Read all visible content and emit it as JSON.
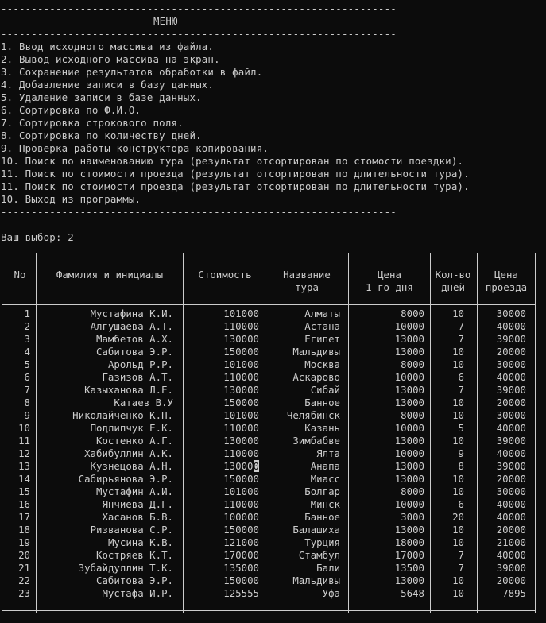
{
  "dash_line": "-----------------------------------------------------------------",
  "menu_title": "МЕНЮ",
  "menu_items": [
    "1. Ввод исходного массива из файла.",
    "2. Вывод исходного массива на экран.",
    "3. Сохранение результатов обработки в файл.",
    "4. Добавление записи в базу данных.",
    "5. Удаление записи в базе данных.",
    "6. Сортировка по Ф.И.О.",
    "7. Сортировка строкового поля.",
    "8. Сортировка по количеству дней.",
    "9. Проверка работы конструктора копирования.",
    "10. Поиск по наименованию тура (результат отсортирован по стомости поездки).",
    "11. Поиск по стоимости проезда (результат отсортирован по длительности тура).",
    "11. Поиск по стоимости проезда (результат отсортирован по длительности тура).",
    "10. Выход из программы."
  ],
  "prompt": "Ваш выбор: 2",
  "table": {
    "headers": {
      "no": "No",
      "name": "Фамилия и инициалы",
      "cost": "Стоимость",
      "tour_1": "Название",
      "tour_2": "тура",
      "price_1": "Цена",
      "price_2": "1-го дня",
      "days_1": "Кол-во",
      "days_2": "дней",
      "fare_1": "Цена",
      "fare_2": "проезда"
    },
    "rows": [
      [
        "1",
        "Мустафина К.И.",
        "101000",
        "Алматы",
        "8000",
        "10",
        "30000"
      ],
      [
        "2",
        "Алгушаева А.Т.",
        "110000",
        "Астана",
        "10000",
        "7",
        "40000"
      ],
      [
        "3",
        "Мамбетов А.Х.",
        "130000",
        "Египет",
        "13000",
        "7",
        "39000"
      ],
      [
        "4",
        "Сабитова Э.Р.",
        "150000",
        "Мальдивы",
        "13000",
        "10",
        "20000"
      ],
      [
        "5",
        "Арольд Р.Р.",
        "101000",
        "Москва",
        "8000",
        "10",
        "30000"
      ],
      [
        "6",
        "Газизов А.Т.",
        "110000",
        "Аскарово",
        "10000",
        "6",
        "40000"
      ],
      [
        "7",
        "Казыханова Л.Е.",
        "130000",
        "Сибай",
        "13000",
        "7",
        "39000"
      ],
      [
        "8",
        "Катаев В.У",
        "150000",
        "Банное",
        "13000",
        "10",
        "20000"
      ],
      [
        "9",
        "Николайченко К.П.",
        "101000",
        "Челябинск",
        "8000",
        "10",
        "30000"
      ],
      [
        "10",
        "Подлипчук Е.К.",
        "110000",
        "Казань",
        "10000",
        "5",
        "40000"
      ],
      [
        "11",
        "Костенко А.Г.",
        "130000",
        "Зимбабве",
        "13000",
        "10",
        "39000"
      ],
      [
        "12",
        "Хабибуллин А.К.",
        "110000",
        "Ялта",
        "10000",
        "9",
        "40000"
      ],
      [
        "13",
        "Кузнецова А.Н.",
        "130000",
        "Анапа",
        "13000",
        "8",
        "39000"
      ],
      [
        "14",
        "Сабирьянова Э.Р.",
        "150000",
        "Миасс",
        "13000",
        "10",
        "20000"
      ],
      [
        "15",
        "Мустафин А.И.",
        "101000",
        "Болгар",
        "8000",
        "10",
        "30000"
      ],
      [
        "16",
        "Янчиева Д.Г.",
        "110000",
        "Минск",
        "10000",
        "6",
        "40000"
      ],
      [
        "17",
        "Хасанов Б.В.",
        "100000",
        "Банное",
        "3000",
        "20",
        "40000"
      ],
      [
        "18",
        "Ризванова С.Р.",
        "150000",
        "Балашиха",
        "13000",
        "10",
        "20000"
      ],
      [
        "19",
        "Мусина К.В.",
        "121000",
        "Турция",
        "18000",
        "10",
        "21000"
      ],
      [
        "20",
        "Костряев К.Т.",
        "170000",
        "Стамбул",
        "17000",
        "7",
        "40000"
      ],
      [
        "21",
        "Зубайдуллин Т.К.",
        "135000",
        "Бали",
        "13500",
        "7",
        "39000"
      ],
      [
        "22",
        "Сабитова Э.Р.",
        "150000",
        "Мальдивы",
        "13000",
        "10",
        "20000"
      ],
      [
        "23",
        "Мустафа И.Р.",
        "125555",
        "Уфа",
        "5648",
        "10",
        "7895"
      ]
    ]
  }
}
